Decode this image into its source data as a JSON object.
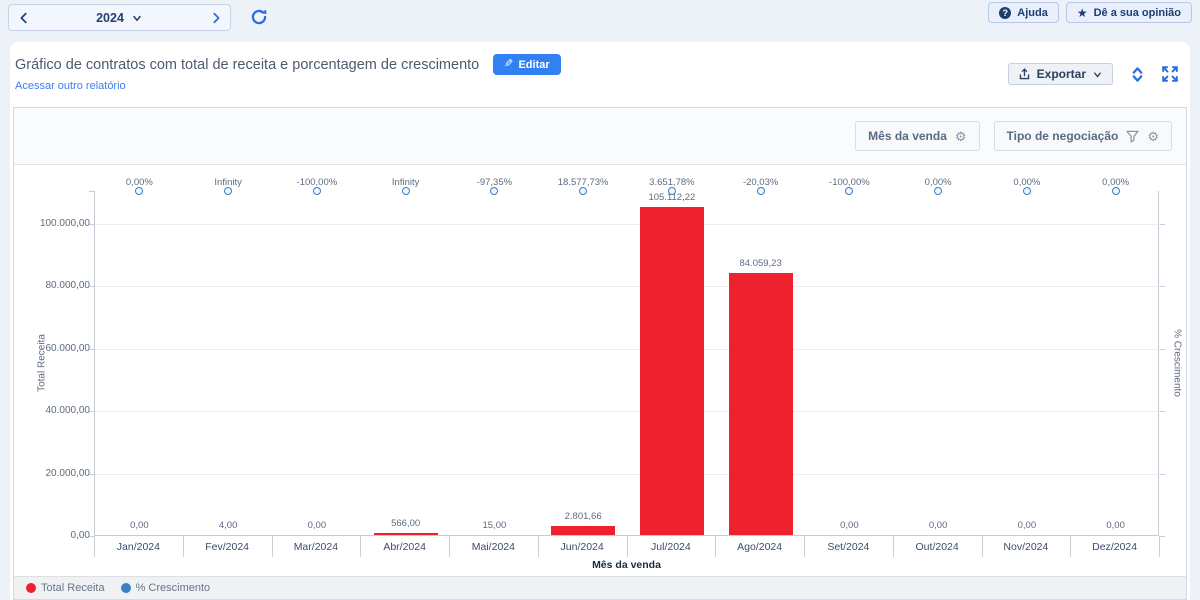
{
  "topbar": {
    "year": "2024",
    "help_label": "Ajuda",
    "feedback_label": "Dê a sua opinião"
  },
  "header": {
    "title": "Gráfico de contratos com total de receita e porcentagem de crescimento",
    "edit_label": "Editar",
    "link_label": "Acessar outro relatório",
    "export_label": "Exportar"
  },
  "filters": {
    "month_field_label": "Mês da venda",
    "deal_type_label": "Tipo de negociação"
  },
  "chart_data": {
    "type": "bar",
    "title": "Gráfico de contratos com total de receita e porcentagem de crescimento",
    "categories": [
      "Jan/2024",
      "Fev/2024",
      "Mar/2024",
      "Abr/2024",
      "Mai/2024",
      "Jun/2024",
      "Jul/2024",
      "Ago/2024",
      "Set/2024",
      "Out/2024",
      "Nov/2024",
      "Dez/2024"
    ],
    "series": [
      {
        "name": "Total Receita",
        "type": "bar",
        "color": "#ee212e",
        "values": [
          0,
          4,
          0,
          566,
          15,
          2801.66,
          105112.22,
          84059.23,
          0,
          0,
          0,
          0
        ],
        "value_labels": [
          "0,00",
          "4,00",
          "0,00",
          "566,00",
          "15,00",
          "2.801,66",
          "105.112,22",
          "84.059,23",
          "0,00",
          "0,00",
          "0,00",
          "0,00"
        ]
      },
      {
        "name": "% Crescimento",
        "type": "scatter",
        "color": "#3a7fc4",
        "value_labels": [
          "0,00%",
          "Infinity",
          "-100,00%",
          "Infinity",
          "-97,35%",
          "18.577,73%",
          "3.651,78%",
          "-20,03%",
          "-100,00%",
          "0,00%",
          "0,00%",
          "0,00%"
        ]
      }
    ],
    "xlabel": "Mês da venda",
    "ylabel_left": "Total Receita",
    "ylabel_right": "% Crescimento",
    "y_ticks": [
      {
        "label": "100.000,00",
        "value": 100000
      },
      {
        "label": "80.000,00",
        "value": 80000
      },
      {
        "label": "60.000,00",
        "value": 60000
      },
      {
        "label": "40.000,00",
        "value": 40000
      },
      {
        "label": "20.000,00",
        "value": 20000
      },
      {
        "label": "0,00",
        "value": 0
      }
    ],
    "ylim": [
      0,
      110000
    ],
    "grid": true,
    "legend_position": "bottom"
  },
  "legend": {
    "items": [
      {
        "label": "Total Receita",
        "color": "#ee212e"
      },
      {
        "label": "% Crescimento",
        "color": "#3a7fc4"
      }
    ]
  }
}
